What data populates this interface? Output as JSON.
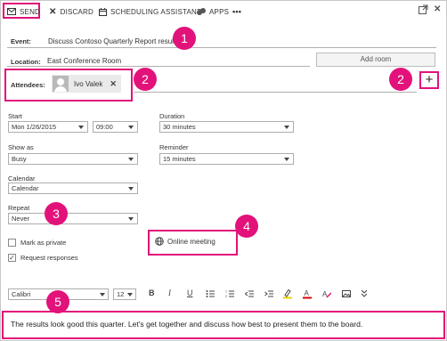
{
  "toolbar": {
    "send": "SEND",
    "discard": "DISCARD",
    "scheduling": "SCHEDULING ASSISTANT",
    "apps": "APPS",
    "more": "•••"
  },
  "event": {
    "label": "Event:",
    "value": "Discuss Contoso Quarterly Report results"
  },
  "location": {
    "label": "Location:",
    "value": "East Conference Room",
    "add_room": "Add room"
  },
  "attendees": {
    "label": "Attendees:",
    "chips": [
      {
        "name": "Ivo Valek",
        "remove": "✕"
      }
    ],
    "add": "+"
  },
  "start": {
    "label": "Start",
    "date": "Mon 1/26/2015",
    "time": "09:00"
  },
  "duration": {
    "label": "Duration",
    "value": "30 minutes"
  },
  "show_as": {
    "label": "Show as",
    "value": "Busy"
  },
  "reminder": {
    "label": "Reminder",
    "value": "15 minutes"
  },
  "calendar": {
    "label": "Calendar",
    "value": "Calendar"
  },
  "repeat": {
    "label": "Repeat",
    "value": "Never"
  },
  "options": {
    "private_label": "Mark as private",
    "private_checked": false,
    "responses_label": "Request responses",
    "responses_checked": true
  },
  "online_meeting": "Online meeting",
  "format": {
    "font": "Calibri",
    "size": "12"
  },
  "body": "The results look good this quarter. Let's get together and discuss how best to present them to the board.",
  "badges": [
    "1",
    "2",
    "2",
    "3",
    "4",
    "5"
  ],
  "colors": {
    "accent": "#e2127a",
    "highlight_yellow": "#f2d100",
    "font_red": "#e00000"
  }
}
